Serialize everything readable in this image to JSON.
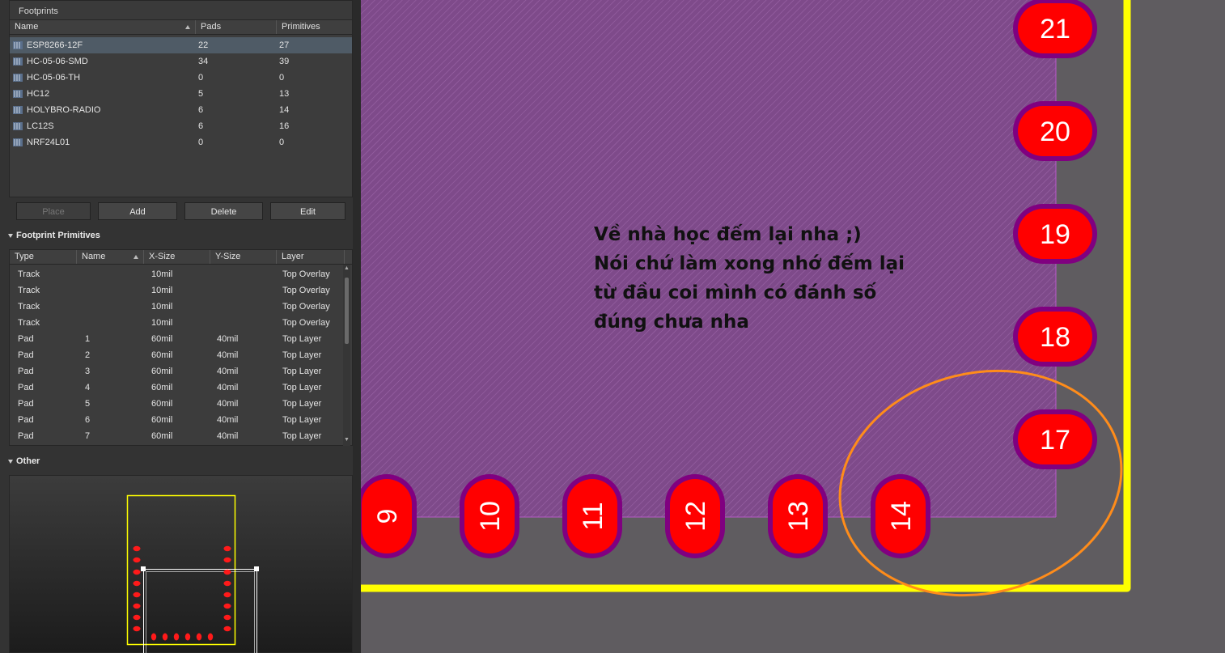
{
  "footprints_panel": {
    "title": "Footprints",
    "columns": [
      "Name",
      "Pads",
      "Primitives"
    ],
    "rows": [
      {
        "name": "ESP8266-12F",
        "pads": "22",
        "primitives": "27"
      },
      {
        "name": "HC-05-06-SMD",
        "pads": "34",
        "primitives": "39"
      },
      {
        "name": "HC-05-06-TH",
        "pads": "0",
        "primitives": "0"
      },
      {
        "name": "HC12",
        "pads": "5",
        "primitives": "13"
      },
      {
        "name": "HOLYBRO-RADIO",
        "pads": "6",
        "primitives": "14"
      },
      {
        "name": "LC12S",
        "pads": "6",
        "primitives": "16"
      },
      {
        "name": "NRF24L01",
        "pads": "0",
        "primitives": "0"
      }
    ],
    "selected_index": 0,
    "buttons": {
      "place": "Place",
      "add": "Add",
      "delete": "Delete",
      "edit": "Edit"
    }
  },
  "primitives_panel": {
    "title": "Footprint Primitives",
    "columns": [
      "Type",
      "Name",
      "X-Size",
      "Y-Size",
      "Layer"
    ],
    "rows": [
      {
        "type": "Track",
        "name": "",
        "xsize": "10mil",
        "ysize": "",
        "layer": "Top Overlay"
      },
      {
        "type": "Track",
        "name": "",
        "xsize": "10mil",
        "ysize": "",
        "layer": "Top Overlay"
      },
      {
        "type": "Track",
        "name": "",
        "xsize": "10mil",
        "ysize": "",
        "layer": "Top Overlay"
      },
      {
        "type": "Track",
        "name": "",
        "xsize": "10mil",
        "ysize": "",
        "layer": "Top Overlay"
      },
      {
        "type": "Pad",
        "name": "1",
        "xsize": "60mil",
        "ysize": "40mil",
        "layer": "Top Layer"
      },
      {
        "type": "Pad",
        "name": "2",
        "xsize": "60mil",
        "ysize": "40mil",
        "layer": "Top Layer"
      },
      {
        "type": "Pad",
        "name": "3",
        "xsize": "60mil",
        "ysize": "40mil",
        "layer": "Top Layer"
      },
      {
        "type": "Pad",
        "name": "4",
        "xsize": "60mil",
        "ysize": "40mil",
        "layer": "Top Layer"
      },
      {
        "type": "Pad",
        "name": "5",
        "xsize": "60mil",
        "ysize": "40mil",
        "layer": "Top Layer"
      },
      {
        "type": "Pad",
        "name": "6",
        "xsize": "60mil",
        "ysize": "40mil",
        "layer": "Top Layer"
      },
      {
        "type": "Pad",
        "name": "7",
        "xsize": "60mil",
        "ysize": "40mil",
        "layer": "Top Layer"
      }
    ]
  },
  "other_panel": {
    "title": "Other"
  },
  "canvas": {
    "note_lines": [
      "Về nhà học đếm lại nha ;)",
      "Nói chứ làm xong nhớ đếm lại",
      "từ đầu coi mình có đánh số",
      "đúng chưa nha"
    ],
    "bottom_pads": [
      "9",
      "10",
      "11",
      "12",
      "13",
      "14"
    ],
    "right_pads": [
      "21",
      "20",
      "19",
      "18",
      "17"
    ],
    "colors": {
      "pad_fill": "#ff0000",
      "pad_ring": "#800080",
      "board_outline": "#ffff00",
      "annotation_ellipse": "#ff8c1a",
      "region": "#7e4a8a",
      "background": "#5f5c60"
    }
  },
  "icons": {
    "footprint": "footprint-icon",
    "sort": "sort-ascending-icon",
    "collapse": "collapse-triangle-icon"
  }
}
